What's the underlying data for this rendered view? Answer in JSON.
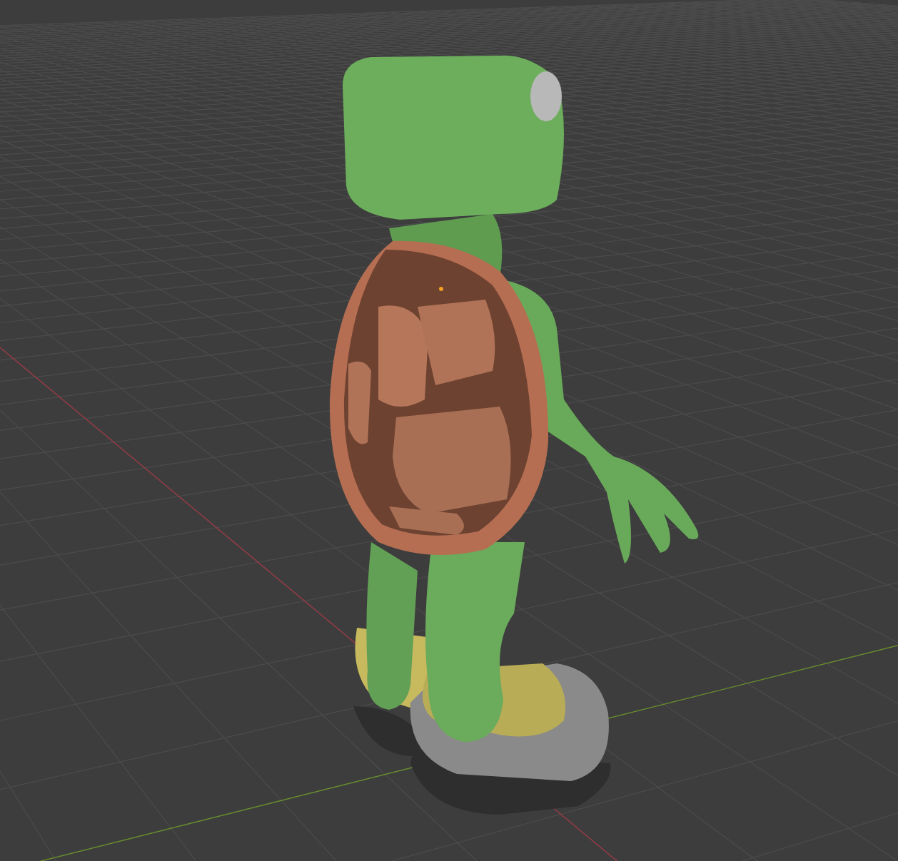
{
  "viewport": {
    "axes": [
      {
        "color": "#9c3b48"
      },
      {
        "color": "#6a8f2e"
      }
    ]
  }
}
